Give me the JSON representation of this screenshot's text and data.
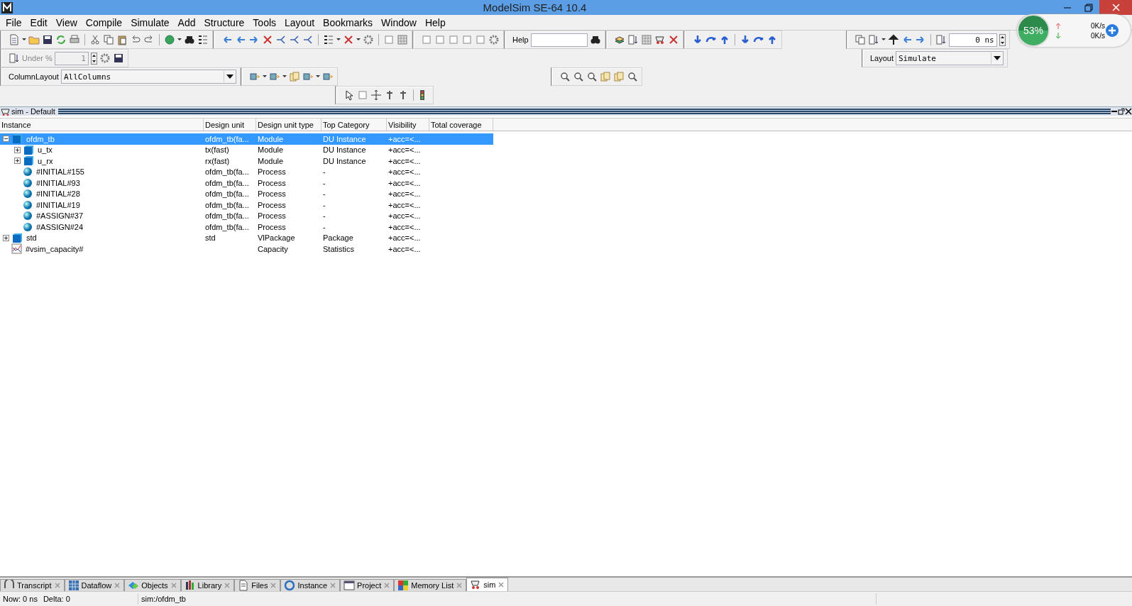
{
  "window": {
    "title": "ModelSim SE-64 10.4"
  },
  "menu": [
    "File",
    "Edit",
    "View",
    "Compile",
    "Simulate",
    "Add",
    "Structure",
    "Tools",
    "Layout",
    "Bookmarks",
    "Window",
    "Help"
  ],
  "toolbar": {
    "help_label": "Help",
    "under_label": "Under %",
    "under_value": "1",
    "time_value": "0",
    "time_unit": "ns",
    "column_layout_label": "ColumnLayout",
    "column_layout_value": "AllColumns",
    "layout_label": "Layout",
    "layout_value": "Simulate"
  },
  "monitor_widget": {
    "percent": "53%",
    "upload": "0K/s",
    "download": "0K/s"
  },
  "panel": {
    "title": "sim - Default"
  },
  "table": {
    "columns": [
      "Instance",
      "Design unit",
      "Design unit type",
      "Top Category",
      "Visibility",
      "Total coverage"
    ],
    "rows": [
      {
        "kind": "module",
        "instance": "ofdm_tb",
        "design_unit": "ofdm_tb(fa...",
        "unit_type": "Module",
        "top_category": "DU Instance",
        "visibility": "+acc=<...",
        "selected": true,
        "expanded": true,
        "children": [
          {
            "kind": "module",
            "instance": "u_tx",
            "design_unit": "tx(fast)",
            "unit_type": "Module",
            "top_category": "DU Instance",
            "visibility": "+acc=<...",
            "selected": false,
            "expanded": false
          },
          {
            "kind": "module",
            "instance": "u_rx",
            "design_unit": "rx(fast)",
            "unit_type": "Module",
            "top_category": "DU Instance",
            "visibility": "+acc=<...",
            "selected": false,
            "expanded": false
          },
          {
            "kind": "process",
            "instance": "#INITIAL#155",
            "design_unit": "ofdm_tb(fa...",
            "unit_type": "Process",
            "top_category": "-",
            "visibility": "+acc=<...",
            "selected": false
          },
          {
            "kind": "process",
            "instance": "#INITIAL#93",
            "design_unit": "ofdm_tb(fa...",
            "unit_type": "Process",
            "top_category": "-",
            "visibility": "+acc=<...",
            "selected": false
          },
          {
            "kind": "process",
            "instance": "#INITIAL#28",
            "design_unit": "ofdm_tb(fa...",
            "unit_type": "Process",
            "top_category": "-",
            "visibility": "+acc=<...",
            "selected": false
          },
          {
            "kind": "process",
            "instance": "#INITIAL#19",
            "design_unit": "ofdm_tb(fa...",
            "unit_type": "Process",
            "top_category": "-",
            "visibility": "+acc=<...",
            "selected": false
          },
          {
            "kind": "process",
            "instance": "#ASSIGN#37",
            "design_unit": "ofdm_tb(fa...",
            "unit_type": "Process",
            "top_category": "-",
            "visibility": "+acc=<...",
            "selected": false
          },
          {
            "kind": "process",
            "instance": "#ASSIGN#24",
            "design_unit": "ofdm_tb(fa...",
            "unit_type": "Process",
            "top_category": "-",
            "visibility": "+acc=<...",
            "selected": false
          }
        ]
      },
      {
        "kind": "module",
        "instance": "std",
        "design_unit": "std",
        "unit_type": "VlPackage",
        "top_category": "Package",
        "visibility": "+acc=<...",
        "selected": false,
        "expanded": false
      },
      {
        "kind": "capacity",
        "instance": "#vsim_capacity#",
        "unit_type": "Capacity",
        "top_category": "Statistics",
        "visibility": "+acc=<...",
        "selected": false
      }
    ]
  },
  "tabs": [
    {
      "label": "Transcript",
      "selected": false
    },
    {
      "label": "Dataflow",
      "selected": false
    },
    {
      "label": "Objects",
      "selected": false
    },
    {
      "label": "Library",
      "selected": false
    },
    {
      "label": "Files",
      "selected": false
    },
    {
      "label": "Instance",
      "selected": false
    },
    {
      "label": "Project",
      "selected": false
    },
    {
      "label": "Memory List",
      "selected": false
    },
    {
      "label": "sim",
      "selected": true
    }
  ],
  "status_bar": {
    "now": "Now: 0 ns",
    "delta": "Delta: 0",
    "context": "sim:/ofdm_tb"
  }
}
